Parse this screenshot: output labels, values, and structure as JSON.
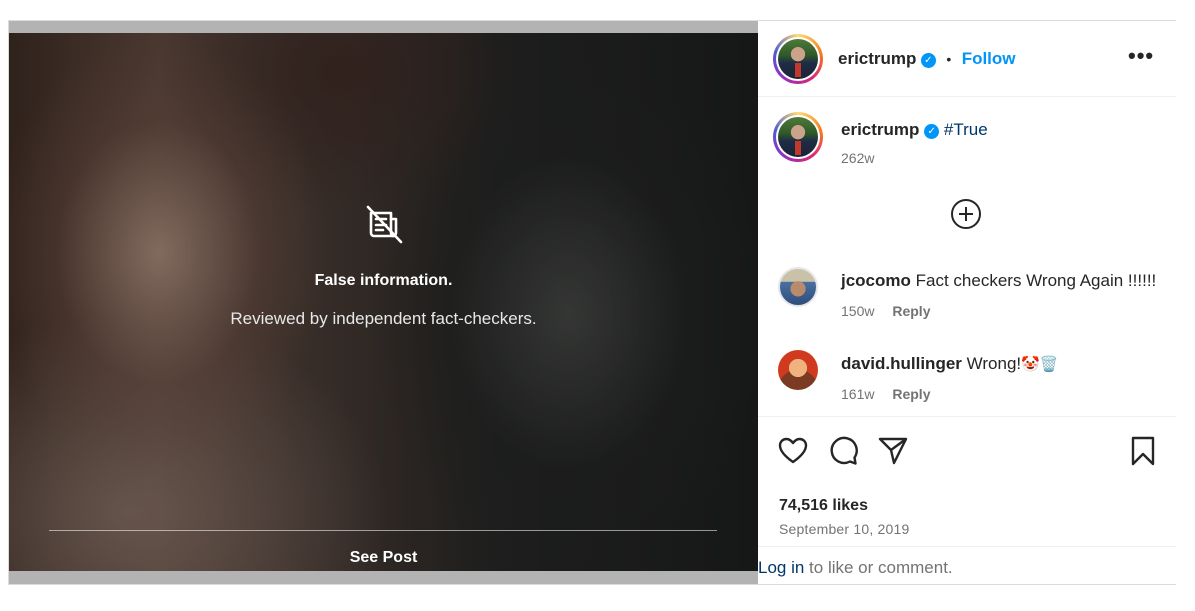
{
  "media": {
    "warning_icon": "no-news-icon",
    "warning_title": "False information.",
    "warning_subtitle": "Reviewed by independent fact-checkers.",
    "see_post_label": "See Post"
  },
  "header": {
    "username": "erictrump",
    "verified_icon": "verified-badge-icon",
    "separator": "•",
    "follow_label": "Follow",
    "more_label": "•••"
  },
  "caption": {
    "username": "erictrump",
    "text": "#True",
    "time": "262w"
  },
  "comments": [
    {
      "username": "jcocomo",
      "text": "Fact checkers Wrong Again !!!!!!",
      "time": "150w",
      "reply_label": "Reply"
    },
    {
      "username": "david.hullinger",
      "text": "Wrong!",
      "emoji": "🤡🗑️",
      "time": "161w",
      "reply_label": "Reply"
    }
  ],
  "actions": {
    "icons": [
      "heart-icon",
      "comment-icon",
      "share-icon",
      "bookmark-icon"
    ],
    "likes": "74,516 likes",
    "date": "September 10, 2019"
  },
  "login": {
    "link_label": "Log in",
    "rest": " to like or comment."
  },
  "colors": {
    "accent": "#0095f6",
    "hashtag": "#00376b",
    "muted": "#737373"
  }
}
